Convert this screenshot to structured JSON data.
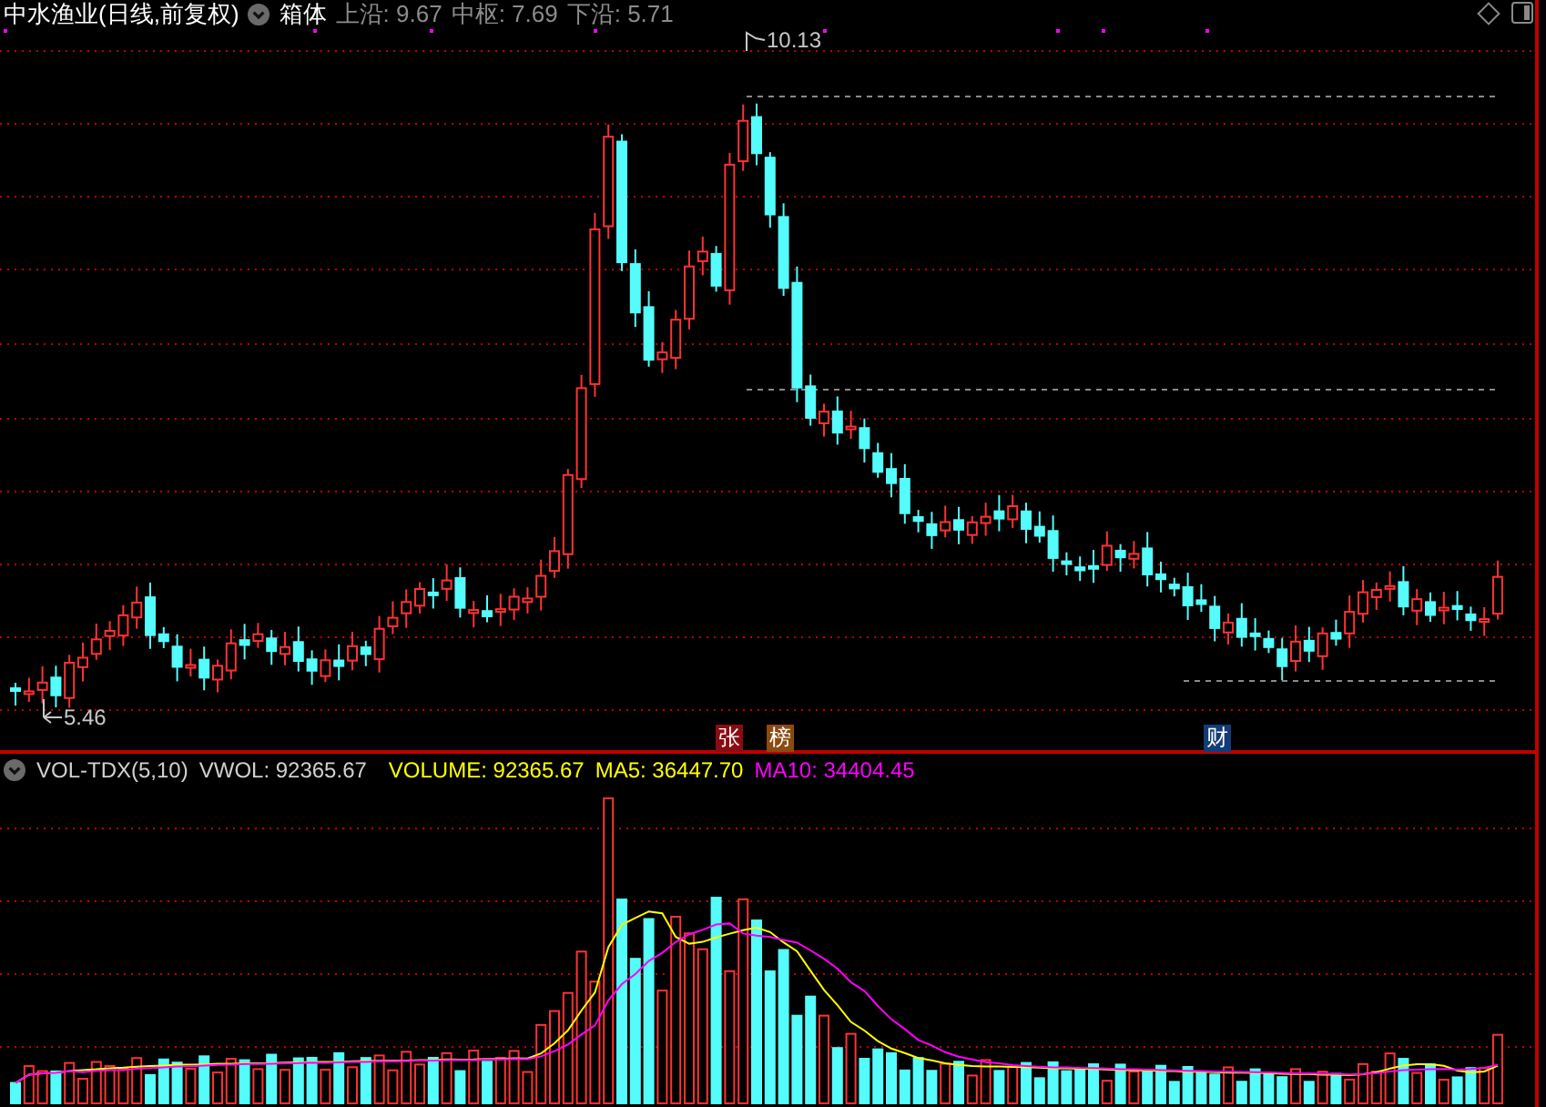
{
  "header": {
    "title": "中水渔业(日线,前复权)",
    "indicator": "箱体",
    "stats": [
      {
        "text": "上沿: 9.67"
      },
      {
        "text": "中枢: 7.69"
      },
      {
        "text": "下沿: 5.71"
      }
    ]
  },
  "price_chart": {
    "high_label": "10.13",
    "low_label": "5.46",
    "event_badges": [
      {
        "text": "张",
        "color": "#8a0c12"
      },
      {
        "text": "榜",
        "color": "#8a4a10"
      },
      {
        "text": "财",
        "color": "#123c78"
      }
    ]
  },
  "volume_panel": {
    "indicator": "VOL-TDX(5,10)",
    "readings": [
      {
        "text": "VWOL: 92365.67",
        "kind": "plain"
      },
      {
        "text": "VOLUME: 92365.67",
        "kind": "volume"
      },
      {
        "text": "MA5: 36447.70",
        "kind": "ma5"
      },
      {
        "text": "MA10: 34404.45",
        "kind": "ma10"
      }
    ]
  }
}
